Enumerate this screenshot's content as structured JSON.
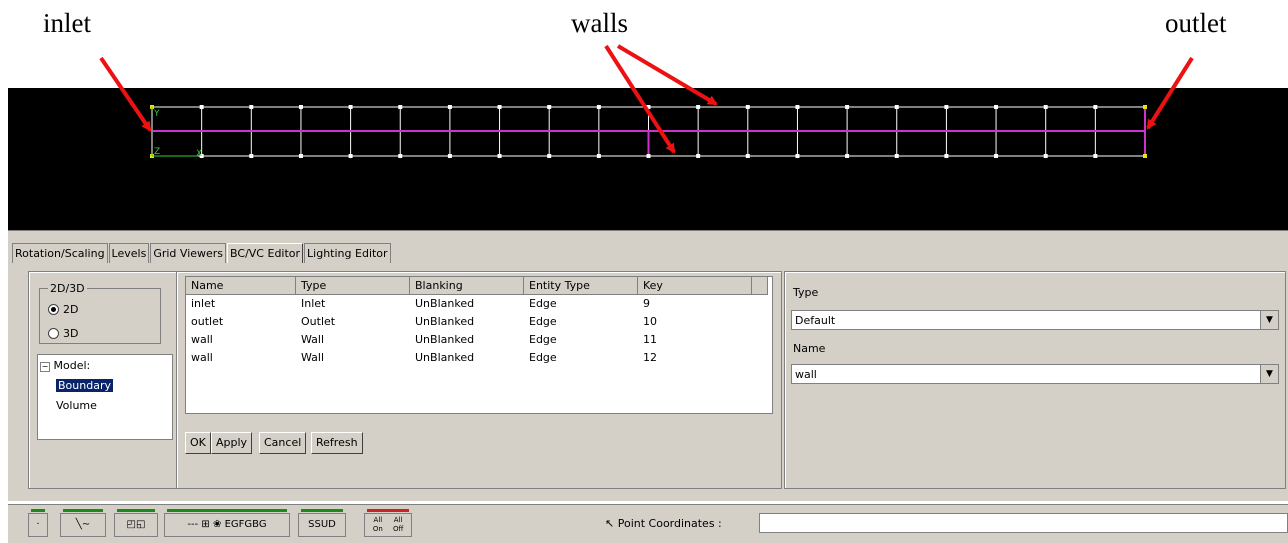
{
  "annotations": {
    "inlet": "inlet",
    "walls": "walls",
    "outlet": "outlet"
  },
  "tabs": [
    "Rotation/Scaling",
    "Levels",
    "Grid Viewers",
    "BC/VC Editor",
    "Lighting Editor"
  ],
  "left": {
    "group_label": "2D/3D",
    "radio_2d": "2D",
    "radio_3d": "3D",
    "tree_root": "Model:",
    "tree_boundary": "Boundary",
    "tree_volume": "Volume"
  },
  "table": {
    "headers": [
      "Name",
      "Type",
      "Blanking",
      "Entity Type",
      "Key"
    ],
    "rows": [
      [
        "inlet",
        "Inlet",
        "UnBlanked",
        "Edge",
        "9"
      ],
      [
        "outlet",
        "Outlet",
        "UnBlanked",
        "Edge",
        "10"
      ],
      [
        "wall",
        "Wall",
        "UnBlanked",
        "Edge",
        "11"
      ],
      [
        "wall",
        "Wall",
        "UnBlanked",
        "Edge",
        "12"
      ]
    ]
  },
  "buttons": {
    "ok": "OK",
    "apply": "Apply",
    "cancel": "Cancel",
    "refresh": "Refresh"
  },
  "right": {
    "type_label": "Type",
    "type_value": "Default",
    "name_label": "Name",
    "name_value": "wall"
  },
  "status": {
    "coords_label": "Point Coordinates :"
  },
  "toolbar": {
    "eg": "EG",
    "fg": "FG",
    "bg": "BG",
    "ss": "SS",
    "ud": "UD",
    "all_on": "All On",
    "all_off": "All Off"
  },
  "colors": {
    "boundary": "#cc33cc",
    "grid": "#ffffff",
    "axis": "#33cc33",
    "corner": "#e6e600",
    "arrow": "#ee1111",
    "highlight": "#0a246a"
  }
}
